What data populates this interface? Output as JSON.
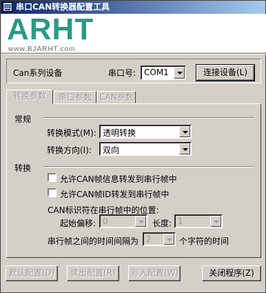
{
  "window": {
    "title": "串口CAN转换器配置工具"
  },
  "logo": {
    "text": "ARHT",
    "url": "www.BJARHT.com"
  },
  "top": {
    "device_label": "Can系列设备",
    "port_label": "串口号:",
    "port_value": "COM1",
    "connect_button": "连接设备(L)"
  },
  "tabs": [
    {
      "label": "转换参数",
      "active": true
    },
    {
      "label": "串口参数",
      "active": false
    },
    {
      "label": "CAN参数",
      "active": false
    }
  ],
  "general": {
    "heading": "常规",
    "mode_label": "转换模式(M):",
    "mode_value": "透明转换",
    "direction_label": "转换方向(I):",
    "direction_value": "双向"
  },
  "convert": {
    "heading": "转换",
    "check_info": {
      "label": "允许CAN帧信息转发到串行帧中",
      "checked": false
    },
    "check_id": {
      "label": "允许CAN帧ID转发到串行帧中",
      "checked": false
    },
    "position_label": "CAN标识符在串行帧中的位置:",
    "offset_label": "起始偏移:",
    "offset_value": "0",
    "length_label": "长度:",
    "length_value": "1",
    "interval_label": "串行帧之间的时间间隔为",
    "interval_value": "2",
    "interval_suffix": "个字符的时间"
  },
  "bottom": {
    "default_button": "默认配置(D)",
    "read_button": "读出配置(R)",
    "write_button": "写入配置(W)",
    "close_button": "关闭程序(Z)"
  }
}
